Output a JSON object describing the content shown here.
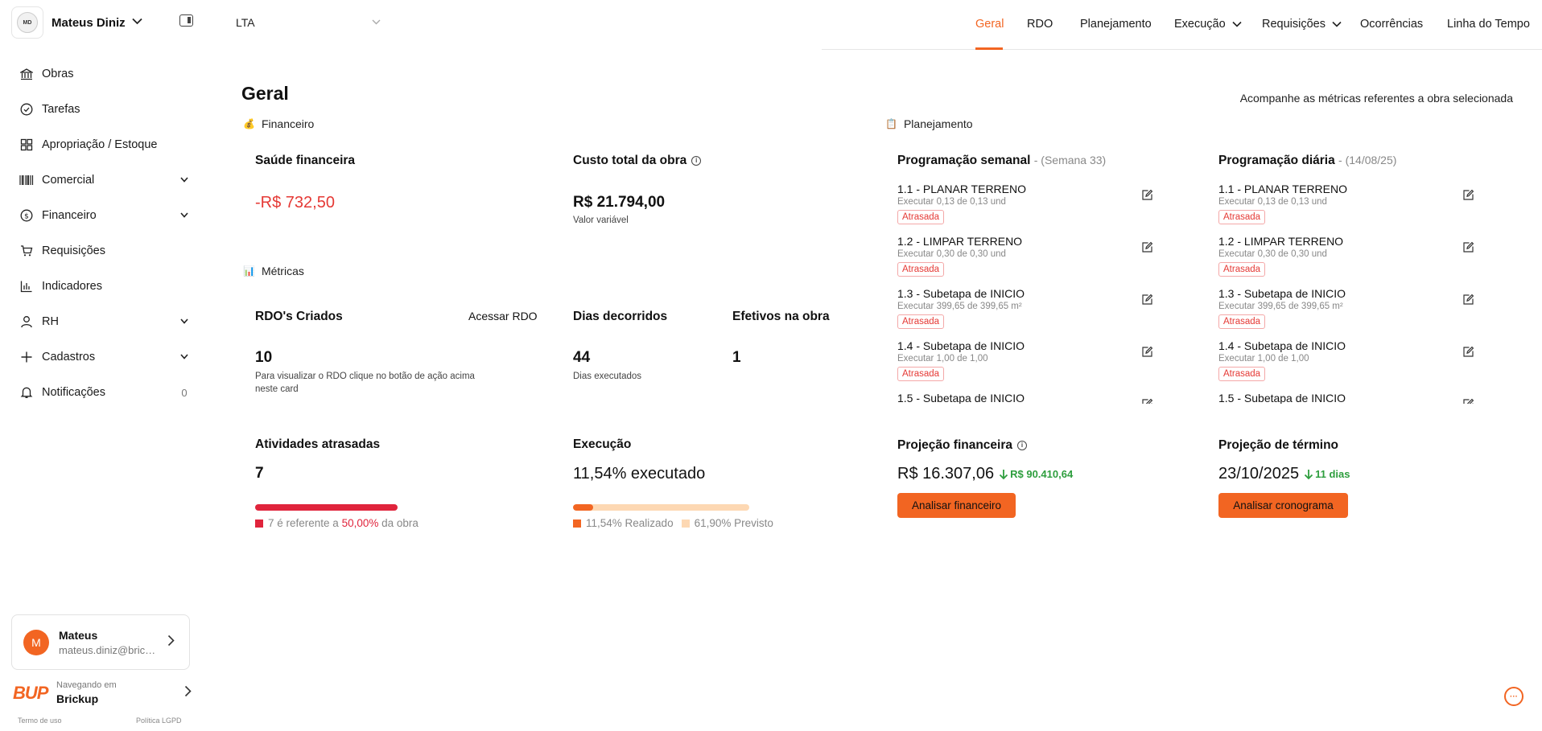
{
  "sidebar": {
    "org_name": "Mateus Diniz",
    "org_logo_text": "MATEUS DINIZ",
    "items": [
      {
        "label": "Obras",
        "icon": "bank-icon",
        "chevron": false
      },
      {
        "label": "Tarefas",
        "icon": "check-circle-icon",
        "chevron": false
      },
      {
        "label": "Apropriação / Estoque",
        "icon": "grid-icon",
        "chevron": false
      },
      {
        "label": "Comercial",
        "icon": "barcode-icon",
        "chevron": true
      },
      {
        "label": "Financeiro",
        "icon": "dollar-circle-icon",
        "chevron": true
      },
      {
        "label": "Requisições",
        "icon": "cart-icon",
        "chevron": false
      },
      {
        "label": "Indicadores",
        "icon": "bar-chart-icon",
        "chevron": false
      },
      {
        "label": "RH",
        "icon": "user-icon",
        "chevron": true
      },
      {
        "label": "Cadastros",
        "icon": "plus-icon",
        "chevron": true
      },
      {
        "label": "Notificações",
        "icon": "bell-icon",
        "chevron": false,
        "count": "0"
      }
    ],
    "user": {
      "initial": "M",
      "name": "Mateus",
      "email": "mateus.diniz@brickup.com.br"
    },
    "brand": {
      "logo": "BUP",
      "sub": "Navegando em",
      "name": "Brickup"
    },
    "legal": {
      "terms": "Termo de uso",
      "privacy": "Política LGPD"
    }
  },
  "topbar": {
    "obra": "LTA",
    "tabs": [
      {
        "label": "Geral",
        "active": true
      },
      {
        "label": "RDO"
      },
      {
        "label": "Planejamento"
      },
      {
        "label": "Execução",
        "dropdown": true
      },
      {
        "label": "Requisições",
        "dropdown": true
      },
      {
        "label": "Ocorrências"
      },
      {
        "label": "Linha do Tempo"
      }
    ]
  },
  "main": {
    "title": "Geral",
    "subtitle": "Acompanhe as métricas referentes a obra selecionada",
    "financeiro": {
      "section": "Financeiro",
      "saude_title": "Saúde financeira",
      "saude_value": "-R$ 732,50",
      "custo_title": "Custo total da obra",
      "custo_value": "R$ 21.794,00",
      "custo_note": "Valor variável"
    },
    "metricas": {
      "section": "Métricas",
      "rdo_title": "RDO's Criados",
      "rdo_link": "Acessar RDO",
      "rdo_value": "10",
      "rdo_note": "Para visualizar o RDO clique no botão de ação acima neste card",
      "dias_title": "Dias decorridos",
      "dias_value": "44",
      "dias_note": "Dias executados",
      "efetivos_title": "Efetivos na obra",
      "efetivos_value": "1"
    },
    "atrasadas": {
      "title": "Atividades atrasadas",
      "value": "7",
      "legend_prefix": "7 é referente a",
      "legend_pct": "50,00%",
      "legend_suffix": "da obra",
      "color": "#e0243c"
    },
    "execucao": {
      "title": "Execução",
      "value": "11,54% executado",
      "realizado_pct": 11.54,
      "previsto_pct": 61.9,
      "realizado_label": "11,54% Realizado",
      "previsto_label": "61,90% Previsto",
      "realizado_color": "#f26522",
      "previsto_color": "#fdd8b3"
    },
    "planejamento": {
      "section": "Planejamento",
      "semanal_title": "Programação semanal",
      "semanal_sub": "- (Semana 33)",
      "diaria_title": "Programação diária",
      "diaria_sub": "- (14/08/25)",
      "items": [
        {
          "title": "1.1 - PLANAR TERRENO",
          "sub": "Executar 0,13 de 0,13 und",
          "badge": "Atrasada"
        },
        {
          "title": "1.2 - LIMPAR TERRENO",
          "sub": "Executar 0,30 de 0,30 und",
          "badge": "Atrasada"
        },
        {
          "title": "1.3 - Subetapa de INICIO",
          "sub": "Executar 399,65 de 399,65 m²",
          "badge": "Atrasada"
        },
        {
          "title": "1.4 - Subetapa de INICIO",
          "sub": "Executar 1,00 de 1,00",
          "badge": "Atrasada"
        },
        {
          "title": "1.5 - Subetapa de INICIO",
          "sub": "",
          "badge": ""
        }
      ]
    },
    "projecao_fin": {
      "title": "Projeção financeira",
      "value": "R$ 16.307,06",
      "delta": "R$ 90.410,64",
      "button": "Analisar financeiro"
    },
    "projecao_term": {
      "title": "Projeção de término",
      "value": "23/10/2025",
      "delta": "11 dias",
      "button": "Analisar cronograma"
    }
  }
}
